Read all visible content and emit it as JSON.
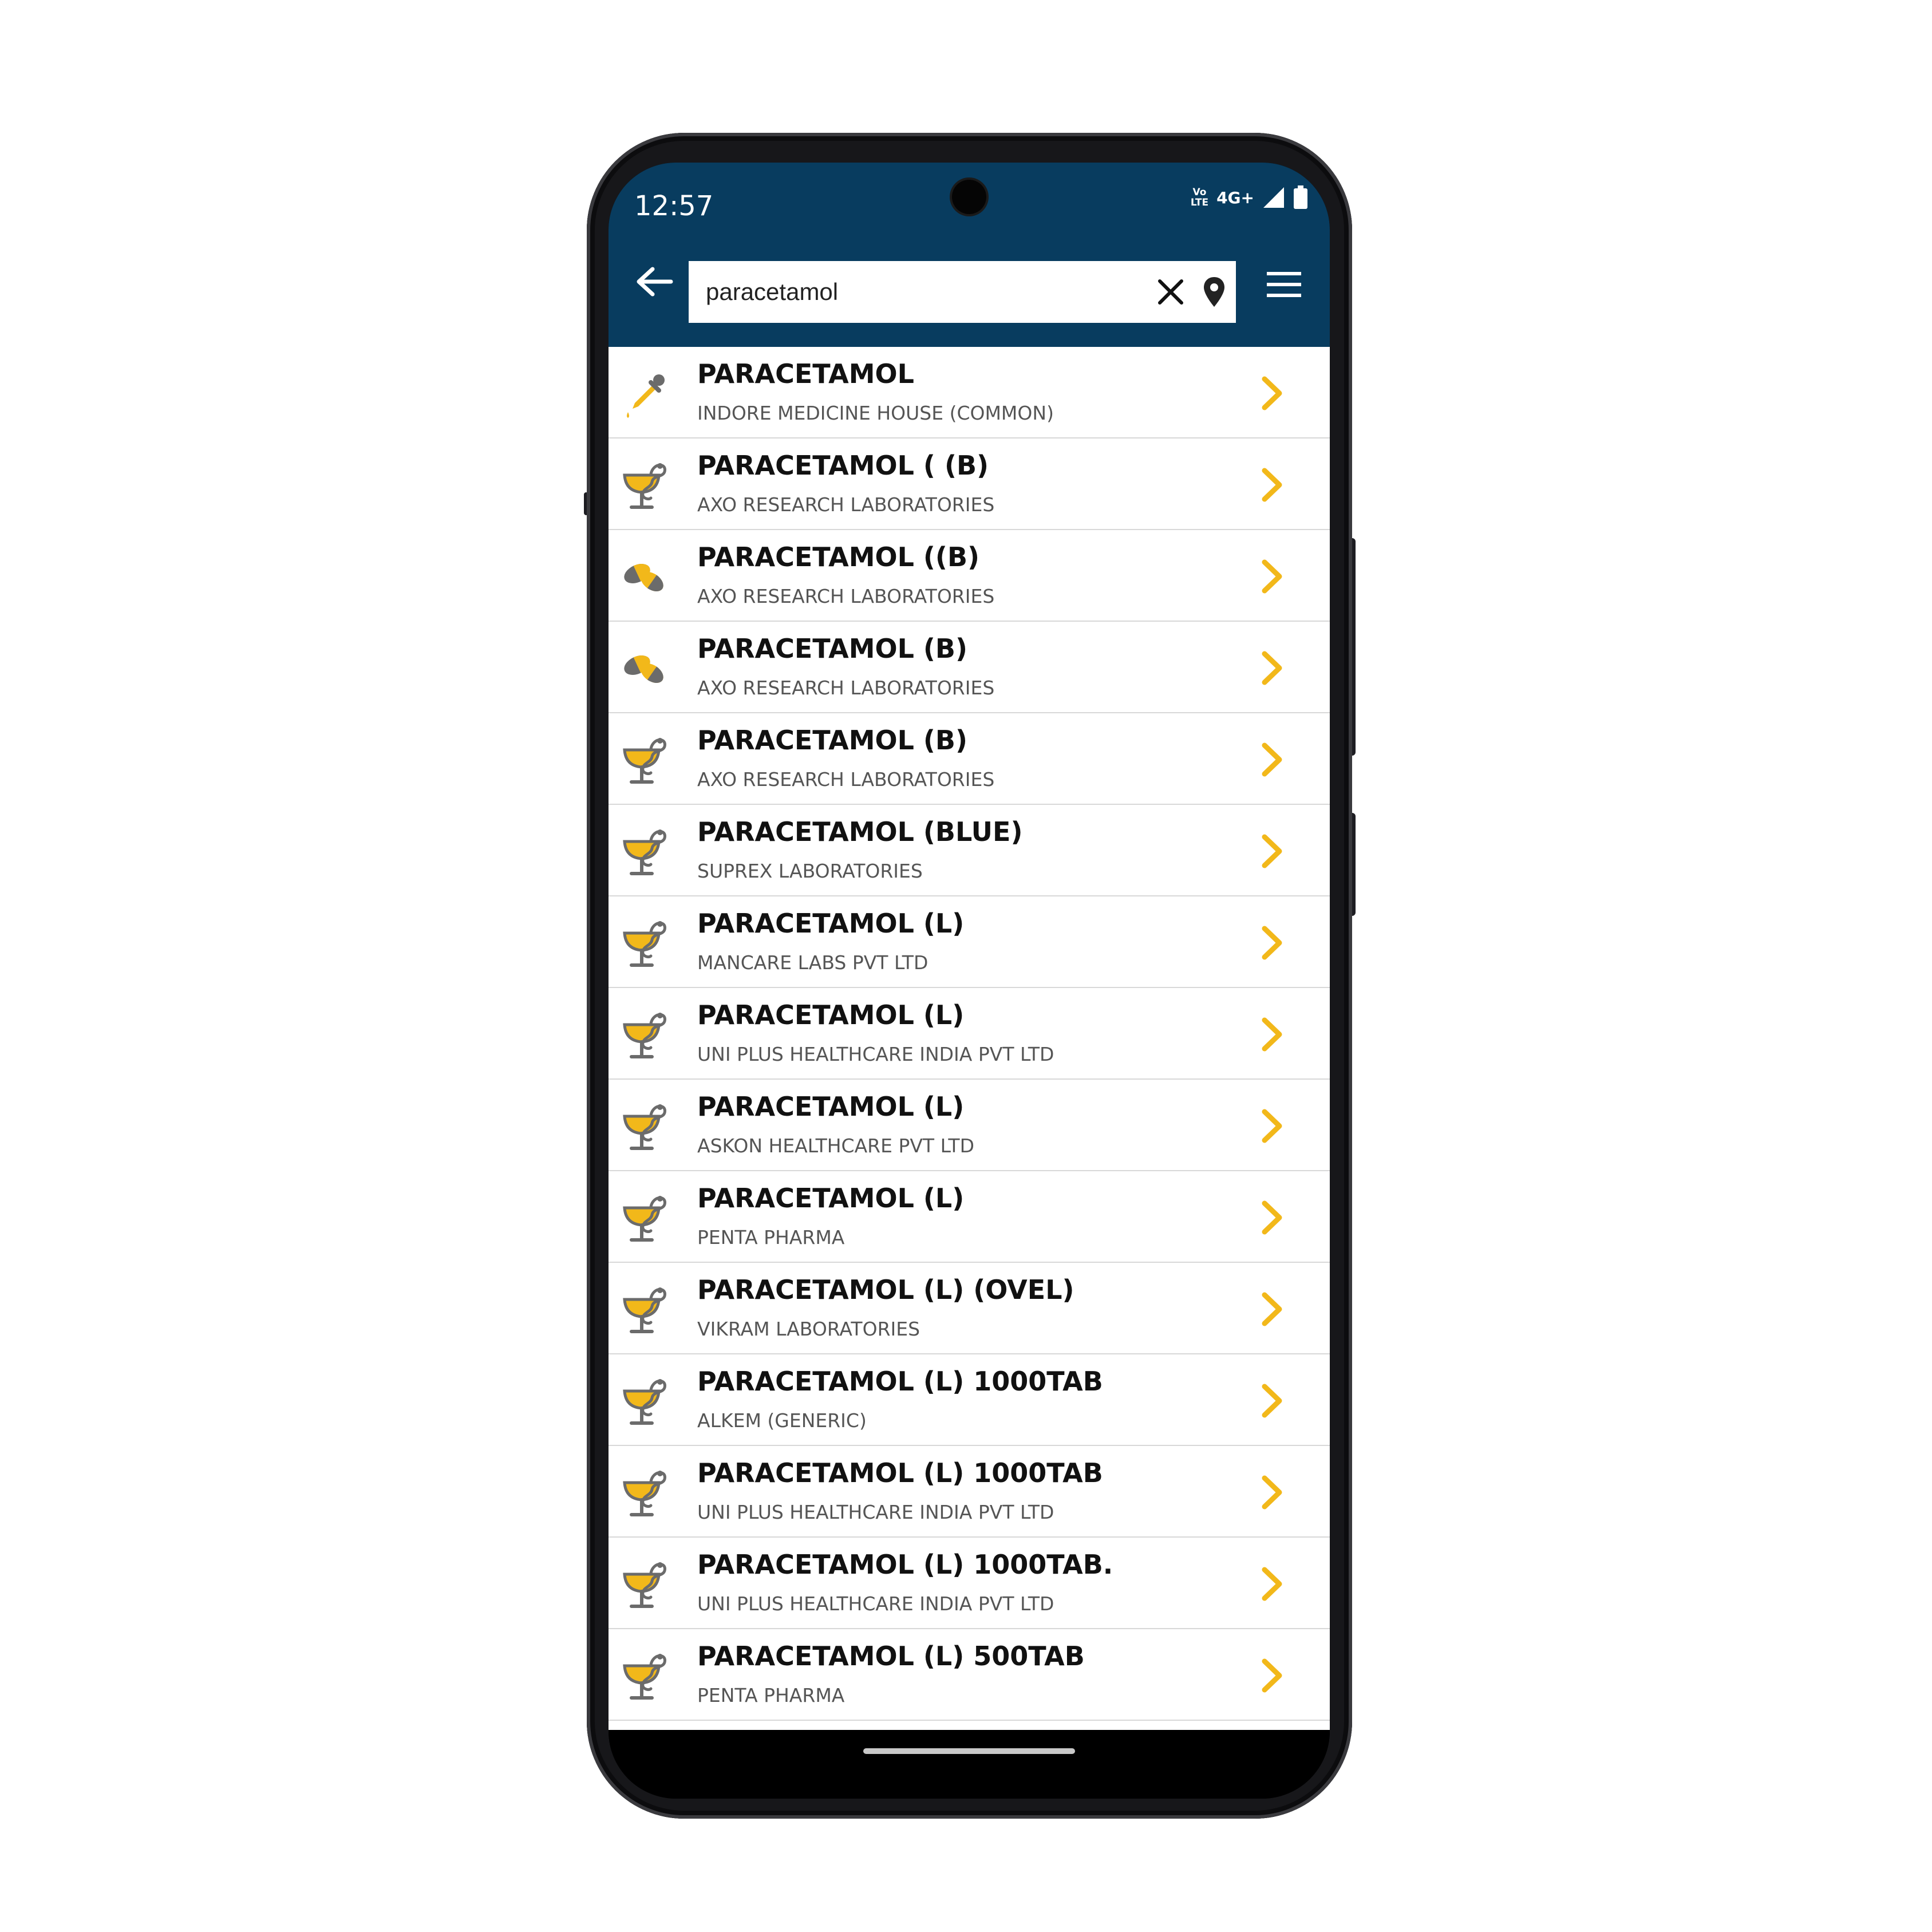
{
  "status": {
    "time": "12:57",
    "volte_line1": "Vo",
    "volte_line2": "LTE",
    "network": "4G+"
  },
  "search": {
    "value": "paracetamol",
    "placeholder": ""
  },
  "colors": {
    "header": "#083c5f",
    "accent": "#f2b81a",
    "icon_gray": "#6b6b6b"
  },
  "results": [
    {
      "icon": "dropper-icon",
      "title": "PARACETAMOL",
      "subtitle": "INDORE MEDICINE HOUSE (COMMON)"
    },
    {
      "icon": "pharmacy-bowl-icon",
      "title": "PARACETAMOL ( (B)",
      "subtitle": "AXO RESEARCH LABORATORIES"
    },
    {
      "icon": "pills-icon",
      "title": "PARACETAMOL ((B)",
      "subtitle": "AXO RESEARCH LABORATORIES"
    },
    {
      "icon": "pills-icon",
      "title": "PARACETAMOL (B)",
      "subtitle": "AXO RESEARCH LABORATORIES"
    },
    {
      "icon": "pharmacy-bowl-icon",
      "title": "PARACETAMOL (B)",
      "subtitle": "AXO RESEARCH LABORATORIES"
    },
    {
      "icon": "pharmacy-bowl-icon",
      "title": "PARACETAMOL (BLUE)",
      "subtitle": "SUPREX LABORATORIES"
    },
    {
      "icon": "pharmacy-bowl-icon",
      "title": "PARACETAMOL (L)",
      "subtitle": "MANCARE LABS PVT LTD"
    },
    {
      "icon": "pharmacy-bowl-icon",
      "title": "PARACETAMOL (L)",
      "subtitle": "UNI PLUS HEALTHCARE INDIA PVT LTD"
    },
    {
      "icon": "pharmacy-bowl-icon",
      "title": "PARACETAMOL (L)",
      "subtitle": "ASKON HEALTHCARE PVT LTD"
    },
    {
      "icon": "pharmacy-bowl-icon",
      "title": "PARACETAMOL (L)",
      "subtitle": "PENTA PHARMA"
    },
    {
      "icon": "pharmacy-bowl-icon",
      "title": "PARACETAMOL (L) (OVEL)",
      "subtitle": "VIKRAM LABORATORIES"
    },
    {
      "icon": "pharmacy-bowl-icon",
      "title": "PARACETAMOL (L) 1000TAB",
      "subtitle": "ALKEM (GENERIC)"
    },
    {
      "icon": "pharmacy-bowl-icon",
      "title": "PARACETAMOL (L) 1000TAB",
      "subtitle": "UNI PLUS HEALTHCARE INDIA PVT LTD"
    },
    {
      "icon": "pharmacy-bowl-icon",
      "title": "PARACETAMOL (L) 1000TAB.",
      "subtitle": "UNI PLUS HEALTHCARE INDIA PVT LTD"
    },
    {
      "icon": "pharmacy-bowl-icon",
      "title": "PARACETAMOL (L) 500TAB",
      "subtitle": "PENTA PHARMA"
    }
  ]
}
